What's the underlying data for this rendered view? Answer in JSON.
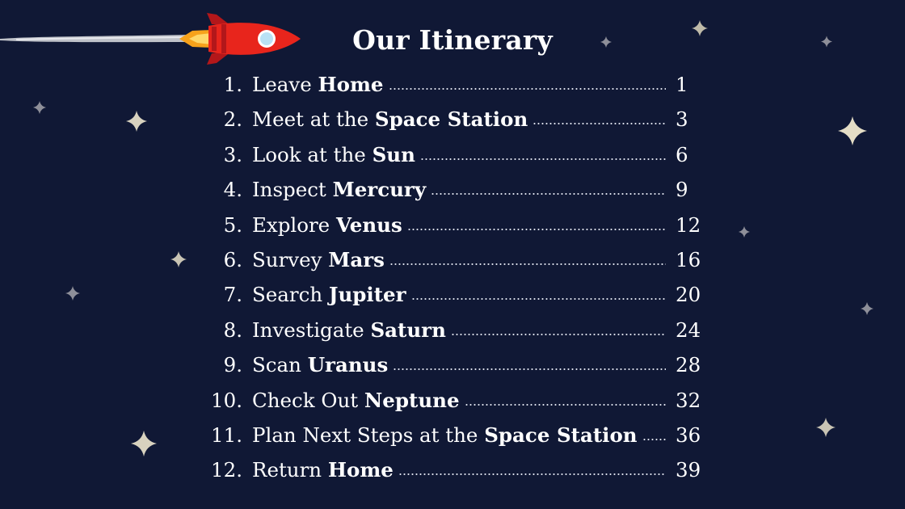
{
  "title": "Our Itinerary",
  "items": [
    {
      "num": "1.",
      "pre": "Leave ",
      "bold": "Home",
      "page": "1"
    },
    {
      "num": "2.",
      "pre": "Meet at the ",
      "bold": "Space Station",
      "page": "3"
    },
    {
      "num": "3.",
      "pre": "Look at the ",
      "bold": "Sun",
      "page": "6"
    },
    {
      "num": "4.",
      "pre": "Inspect ",
      "bold": "Mercury",
      "page": "9"
    },
    {
      "num": "5.",
      "pre": "Explore ",
      "bold": "Venus",
      "page": "12"
    },
    {
      "num": "6.",
      "pre": "Survey ",
      "bold": "Mars",
      "page": "16"
    },
    {
      "num": "7.",
      "pre": "Search ",
      "bold": "Jupiter",
      "page": "20"
    },
    {
      "num": "8.",
      "pre": "Investigate ",
      "bold": "Saturn",
      "page": "24"
    },
    {
      "num": "9.",
      "pre": "Scan ",
      "bold": "Uranus",
      "page": "28"
    },
    {
      "num": "10.",
      "pre": "Check Out ",
      "bold": "Neptune",
      "page": "32"
    },
    {
      "num": "11.",
      "pre": "Plan Next Steps at the ",
      "bold": "Space Station",
      "page": "36"
    },
    {
      "num": "12.",
      "pre": "Return ",
      "bold": "Home",
      "page": "39"
    }
  ],
  "decor": {
    "rocket": "rocket-icon",
    "star": "star-icon",
    "colors": {
      "background": "#101835",
      "rocket": "#e8251c",
      "flame": "#f7a21b",
      "star": "#d8d2bf"
    }
  }
}
